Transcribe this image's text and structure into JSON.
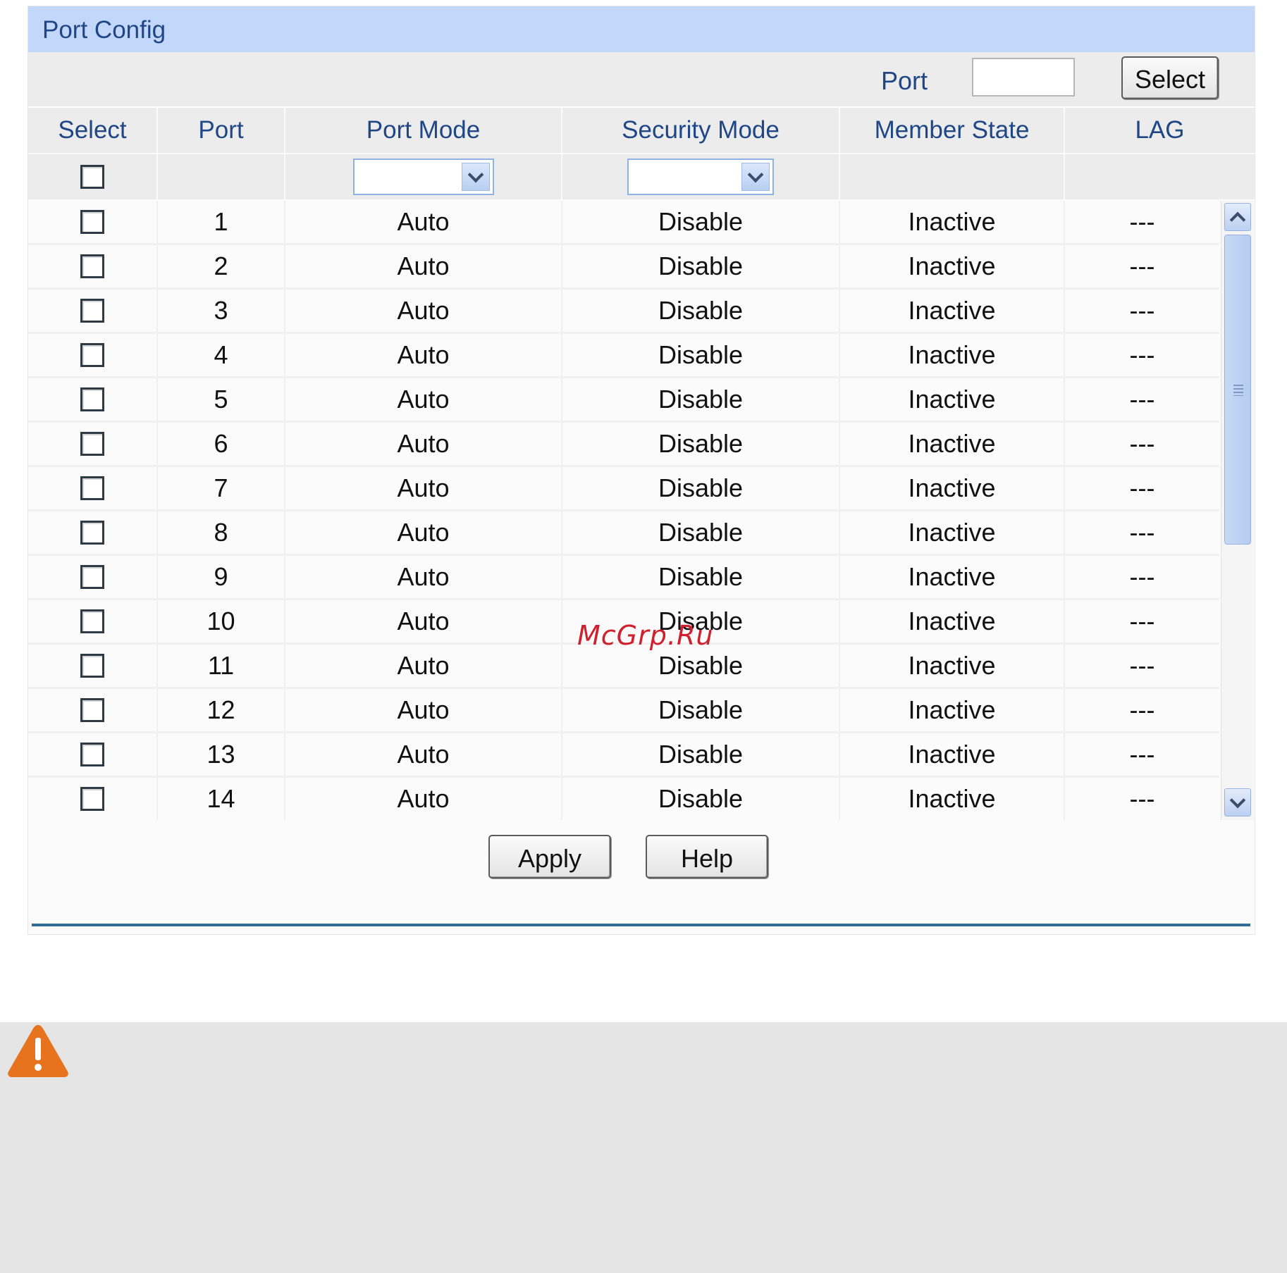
{
  "title": "Port Config",
  "port_search": {
    "label": "Port",
    "value": "",
    "button_label": "Select"
  },
  "table": {
    "columns": [
      "Select",
      "Port",
      "Port Mode",
      "Security Mode",
      "Member State",
      "LAG"
    ],
    "rows": [
      {
        "port": "1",
        "port_mode": "Auto",
        "security_mode": "Disable",
        "member_state": "Inactive",
        "lag": "---"
      },
      {
        "port": "2",
        "port_mode": "Auto",
        "security_mode": "Disable",
        "member_state": "Inactive",
        "lag": "---"
      },
      {
        "port": "3",
        "port_mode": "Auto",
        "security_mode": "Disable",
        "member_state": "Inactive",
        "lag": "---"
      },
      {
        "port": "4",
        "port_mode": "Auto",
        "security_mode": "Disable",
        "member_state": "Inactive",
        "lag": "---"
      },
      {
        "port": "5",
        "port_mode": "Auto",
        "security_mode": "Disable",
        "member_state": "Inactive",
        "lag": "---"
      },
      {
        "port": "6",
        "port_mode": "Auto",
        "security_mode": "Disable",
        "member_state": "Inactive",
        "lag": "---"
      },
      {
        "port": "7",
        "port_mode": "Auto",
        "security_mode": "Disable",
        "member_state": "Inactive",
        "lag": "---"
      },
      {
        "port": "8",
        "port_mode": "Auto",
        "security_mode": "Disable",
        "member_state": "Inactive",
        "lag": "---"
      },
      {
        "port": "9",
        "port_mode": "Auto",
        "security_mode": "Disable",
        "member_state": "Inactive",
        "lag": "---"
      },
      {
        "port": "10",
        "port_mode": "Auto",
        "security_mode": "Disable",
        "member_state": "Inactive",
        "lag": "---"
      },
      {
        "port": "11",
        "port_mode": "Auto",
        "security_mode": "Disable",
        "member_state": "Inactive",
        "lag": "---"
      },
      {
        "port": "12",
        "port_mode": "Auto",
        "security_mode": "Disable",
        "member_state": "Inactive",
        "lag": "---"
      },
      {
        "port": "13",
        "port_mode": "Auto",
        "security_mode": "Disable",
        "member_state": "Inactive",
        "lag": "---"
      },
      {
        "port": "14",
        "port_mode": "Auto",
        "security_mode": "Disable",
        "member_state": "Inactive",
        "lag": "---"
      }
    ]
  },
  "actions": {
    "apply_label": "Apply",
    "help_label": "Help"
  },
  "watermark": "McGrp.Ru",
  "icons": {
    "note": "warning-icon",
    "dropdown": "chevron-down-icon",
    "scroll_up": "chevron-up-icon",
    "scroll_down": "chevron-down-icon"
  },
  "colors": {
    "title_bar": "#c3d7fa",
    "label_text": "#1f4685",
    "divider": "#2f6f97",
    "warning": "#e8731f",
    "watermark": "#d0202e"
  }
}
